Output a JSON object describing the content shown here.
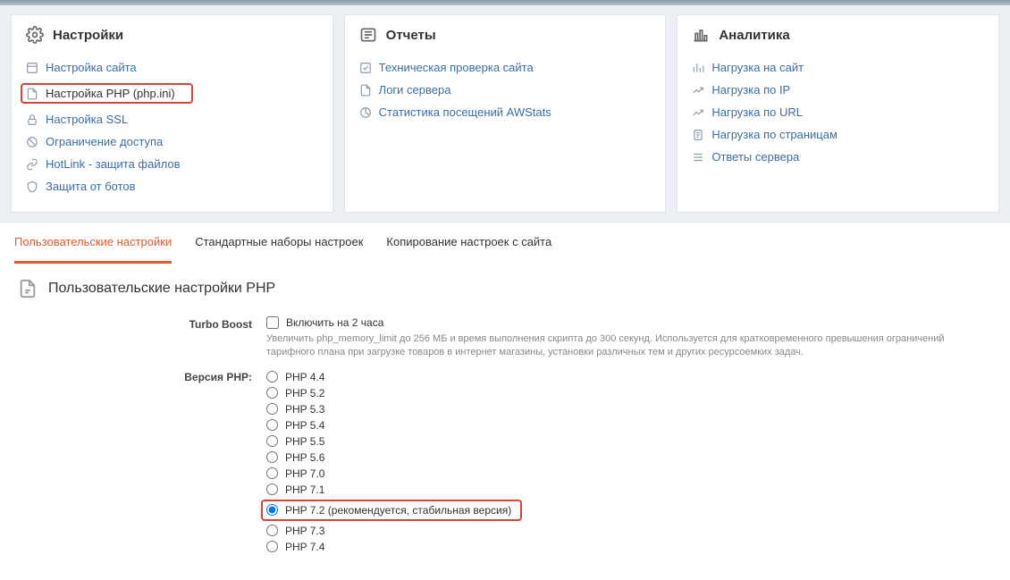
{
  "cards": {
    "settings": {
      "title": "Настройки",
      "items": [
        {
          "label": "Настройка сайта"
        },
        {
          "label": "Настройка PHP (php.ini)"
        },
        {
          "label": "Настройка SSL"
        },
        {
          "label": "Ограничение доступа"
        },
        {
          "label": "HotLink - защита файлов"
        },
        {
          "label": "Защита от ботов"
        }
      ]
    },
    "reports": {
      "title": "Отчеты",
      "items": [
        {
          "label": "Техническая проверка сайта"
        },
        {
          "label": "Логи сервера"
        },
        {
          "label": "Статистика посещений AWStats"
        }
      ]
    },
    "analytics": {
      "title": "Аналитика",
      "items": [
        {
          "label": "Нагрузка на сайт"
        },
        {
          "label": "Нагрузка по IP"
        },
        {
          "label": "Нагрузка по URL"
        },
        {
          "label": "Нагрузка по страницам"
        },
        {
          "label": "Ответы сервера"
        }
      ]
    }
  },
  "tabs": [
    "Пользовательские настройки",
    "Стандартные наборы настроек",
    "Копирование настроек с сайта"
  ],
  "panel": {
    "title": "Пользовательские настройки PHP",
    "turbo": {
      "label": "Turbo Boost",
      "checkbox_label": "Включить на 2 часа",
      "hint": "Увеличить php_memory_limit до 256 МБ и время выполнения скрипта до 300 секунд. Используется для кратковременного превышения ограничений тарифного плана при загрузке товаров в интернет магазины, установки различных тем и других ресурсоемких задач."
    },
    "php_version": {
      "label": "Версия PHP:",
      "options": [
        "PHP 4.4",
        "PHP 5.2",
        "PHP 5.3",
        "PHP 5.4",
        "PHP 5.5",
        "PHP 5.6",
        "PHP 7.0",
        "PHP 7.1",
        "PHP 7.2 (рекомендуется, стабильная версия)",
        "PHP 7.3",
        "PHP 7.4"
      ]
    }
  }
}
